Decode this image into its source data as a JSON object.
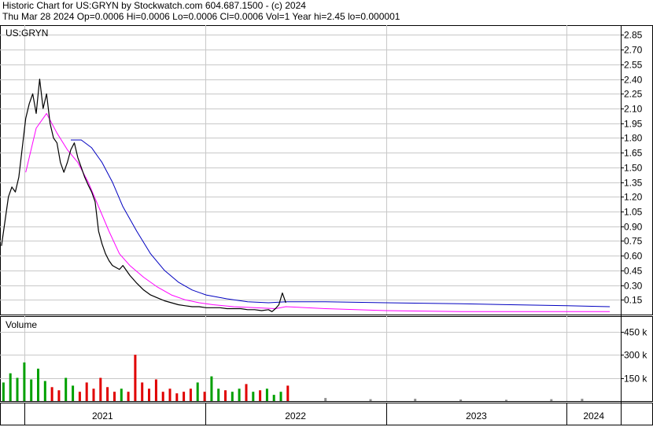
{
  "header": {
    "line1": "Historic Chart for US:GRYN by Stockwatch.com 604.687.1500 - (c) 2024",
    "line2": "Thu Mar 28 2024  Op=0.0006  Hi=0.0006  Lo=0.0006  Cl=0.0006  Vol=1  Year hi=2.45  lo=0.000001"
  },
  "price_panel": {
    "label": "US:GRYN"
  },
  "volume_panel": {
    "label": "Volume"
  },
  "colors": {
    "price": "#000000",
    "ma_short": "#ff00ff",
    "ma_long": "#0000c0",
    "vol_up": "#00a000",
    "vol_down": "#e00000",
    "vol_flat": "#909090",
    "grid": "#c8c8c8"
  },
  "chart_data": [
    {
      "type": "line",
      "series": [
        {
          "name": "Price",
          "x": [
            "2020-11-16",
            "2020-11-23",
            "2020-11-30",
            "2020-12-07",
            "2020-12-14",
            "2020-12-21",
            "2020-12-28",
            "2021-01-04",
            "2021-01-11",
            "2021-01-18",
            "2021-01-25",
            "2021-02-01",
            "2021-02-08",
            "2021-02-15",
            "2021-02-22",
            "2021-03-01",
            "2021-03-08",
            "2021-03-15",
            "2021-03-22",
            "2021-03-29",
            "2021-04-05",
            "2021-04-12",
            "2021-04-19",
            "2021-04-26",
            "2021-05-03",
            "2021-05-10",
            "2021-05-17",
            "2021-05-24",
            "2021-05-31",
            "2021-06-07",
            "2021-06-14",
            "2021-06-21",
            "2021-06-28",
            "2021-07-05",
            "2021-07-12",
            "2021-07-19",
            "2021-07-26",
            "2021-08-02",
            "2021-08-16",
            "2021-08-30",
            "2021-09-13",
            "2021-09-27",
            "2021-10-11",
            "2021-10-25",
            "2021-11-08",
            "2021-11-22",
            "2021-12-06",
            "2021-12-20",
            "2022-01-03",
            "2022-01-17",
            "2022-01-31",
            "2022-02-14",
            "2022-02-28",
            "2022-03-14",
            "2022-03-28",
            "2022-04-11",
            "2022-04-25",
            "2022-05-09",
            "2022-05-16",
            "2022-05-23",
            "2022-05-30",
            "2022-06-06",
            "2022-06-13"
          ],
          "values": [
            0.7,
            0.95,
            1.2,
            1.3,
            1.25,
            1.4,
            1.7,
            2.0,
            2.15,
            2.25,
            2.05,
            2.4,
            2.1,
            2.25,
            1.95,
            1.8,
            1.75,
            1.55,
            1.45,
            1.55,
            1.68,
            1.75,
            1.6,
            1.5,
            1.4,
            1.32,
            1.25,
            1.15,
            0.85,
            0.72,
            0.62,
            0.55,
            0.5,
            0.48,
            0.46,
            0.5,
            0.45,
            0.4,
            0.32,
            0.25,
            0.2,
            0.17,
            0.14,
            0.12,
            0.1,
            0.09,
            0.08,
            0.08,
            0.07,
            0.07,
            0.07,
            0.06,
            0.06,
            0.06,
            0.05,
            0.05,
            0.04,
            0.05,
            0.03,
            0.06,
            0.1,
            0.22,
            0.12
          ]
        },
        {
          "name": "Moving average (short)",
          "x": [
            "2021-01-04",
            "2021-01-25",
            "2021-02-15",
            "2021-03-08",
            "2021-03-29",
            "2021-04-19",
            "2021-05-10",
            "2021-05-31",
            "2021-06-21",
            "2021-07-12",
            "2021-08-02",
            "2021-08-30",
            "2021-09-27",
            "2021-10-25",
            "2021-11-22",
            "2021-12-20",
            "2022-01-17",
            "2022-02-28",
            "2022-04-11",
            "2022-05-23",
            "2022-06-13",
            "2022-09-01",
            "2023-01-01",
            "2023-06-01",
            "2024-01-01",
            "2024-03-28"
          ],
          "values": [
            1.45,
            1.9,
            2.05,
            1.85,
            1.68,
            1.55,
            1.35,
            1.1,
            0.85,
            0.62,
            0.5,
            0.38,
            0.28,
            0.2,
            0.15,
            0.12,
            0.1,
            0.08,
            0.07,
            0.06,
            0.08,
            0.06,
            0.04,
            0.03,
            0.03,
            0.03
          ]
        },
        {
          "name": "Moving average (long)",
          "x": [
            "2021-04-05",
            "2021-04-26",
            "2021-05-17",
            "2021-06-07",
            "2021-06-28",
            "2021-07-19",
            "2021-08-16",
            "2021-09-13",
            "2021-10-11",
            "2021-11-08",
            "2021-12-06",
            "2022-01-03",
            "2022-02-14",
            "2022-03-28",
            "2022-05-09",
            "2022-06-13",
            "2022-09-01",
            "2023-01-01",
            "2023-06-01",
            "2024-01-01",
            "2024-03-28"
          ],
          "values": [
            1.78,
            1.78,
            1.7,
            1.55,
            1.35,
            1.1,
            0.85,
            0.62,
            0.45,
            0.33,
            0.25,
            0.2,
            0.16,
            0.13,
            0.12,
            0.13,
            0.13,
            0.12,
            0.11,
            0.09,
            0.08
          ]
        }
      ],
      "ylim": [
        0,
        2.95
      ],
      "yticks": [
        "2.85",
        "2.70",
        "2.55",
        "2.40",
        "2.25",
        "2.10",
        "1.95",
        "1.80",
        "1.65",
        "1.50",
        "1.35",
        "1.20",
        "1.05",
        "0.90",
        "0.75",
        "0.60",
        "0.45",
        "0.30",
        "0.15"
      ],
      "xlim": [
        "2020-11-13",
        "2024-04-19"
      ],
      "grid": true
    },
    {
      "type": "bar",
      "title": "Volume",
      "x": [
        "2020-11-20",
        "2020-12-04",
        "2020-12-18",
        "2021-01-01",
        "2021-01-15",
        "2021-01-29",
        "2021-02-12",
        "2021-02-26",
        "2021-03-12",
        "2021-03-26",
        "2021-04-09",
        "2021-04-23",
        "2021-05-07",
        "2021-05-21",
        "2021-06-04",
        "2021-06-18",
        "2021-07-02",
        "2021-07-16",
        "2021-07-30",
        "2021-08-13",
        "2021-08-27",
        "2021-09-10",
        "2021-09-24",
        "2021-10-08",
        "2021-10-22",
        "2021-11-05",
        "2021-11-19",
        "2021-12-03",
        "2021-12-17",
        "2021-12-31",
        "2022-01-14",
        "2022-01-28",
        "2022-02-11",
        "2022-02-25",
        "2022-03-11",
        "2022-03-25",
        "2022-04-08",
        "2022-04-22",
        "2022-05-06",
        "2022-05-20",
        "2022-06-03",
        "2022-06-17",
        "2022-09-01",
        "2022-12-01",
        "2023-03-01",
        "2023-06-01",
        "2023-09-01",
        "2023-12-01",
        "2024-02-01"
      ],
      "values": [
        120,
        180,
        150,
        250,
        140,
        210,
        130,
        90,
        70,
        150,
        100,
        60,
        120,
        80,
        150,
        90,
        60,
        80,
        60,
        300,
        120,
        80,
        140,
        60,
        80,
        50,
        60,
        80,
        120,
        60,
        160,
        80,
        70,
        60,
        80,
        110,
        60,
        70,
        80,
        40,
        60,
        100,
        20,
        12,
        15,
        10,
        8,
        12,
        15
      ],
      "yticks": [
        "450 k",
        "300 k",
        "150 k"
      ],
      "ylim": [
        0,
        550
      ],
      "xticks": [
        "2021",
        "2022",
        "2023",
        "2024"
      ],
      "grid": true
    }
  ]
}
